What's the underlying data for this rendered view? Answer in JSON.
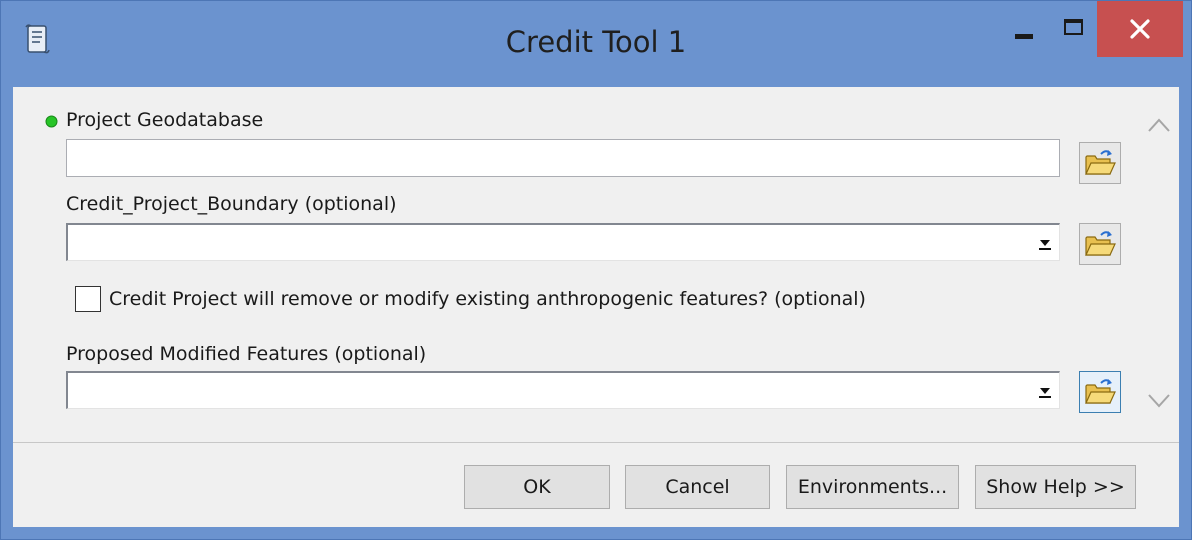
{
  "window": {
    "title": "Credit Tool 1",
    "colors": {
      "titlebar": "#6b93cf",
      "close": "#c75050",
      "required_dot": "#27c427"
    }
  },
  "form": {
    "project_gdb": {
      "label": "Project Geodatabase",
      "value": "",
      "required": true,
      "browse_icon": "open-folder-icon"
    },
    "boundary": {
      "label": "Credit_Project_Boundary (optional)",
      "value": "",
      "browse_icon": "open-folder-icon"
    },
    "modify_checkbox": {
      "label": "Credit Project will remove or modify existing anthropogenic features? (optional)",
      "checked": false
    },
    "modified_features": {
      "label": "Proposed Modified Features (optional)",
      "value": "",
      "browse_icon": "open-folder-icon"
    }
  },
  "buttons": {
    "ok": "OK",
    "cancel": "Cancel",
    "environments": "Environments...",
    "help": "Show Help >>"
  }
}
